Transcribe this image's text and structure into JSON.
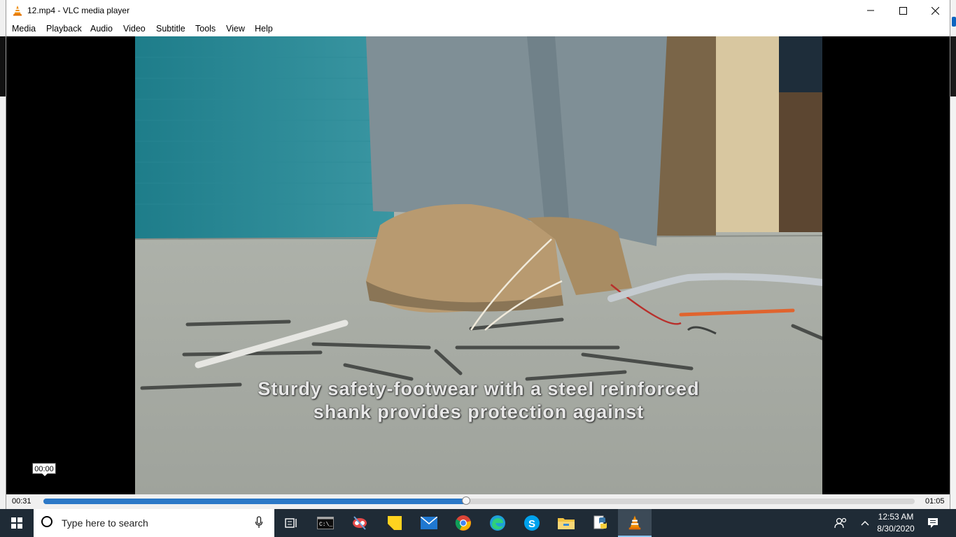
{
  "window": {
    "title": "12.mp4 - VLC media player"
  },
  "menu": [
    "Media",
    "Playback",
    "Audio",
    "Video",
    "Subtitle",
    "Tools",
    "View",
    "Help"
  ],
  "video": {
    "subtitle_line1": "Sturdy safety-footwear with a steel reinforced",
    "subtitle_line2": "shank provides protection against"
  },
  "seek": {
    "hover_time": "00:00",
    "elapsed": "00:31",
    "total": "01:05",
    "progress": 0.485
  },
  "taskbar": {
    "search_placeholder": "Type here to search",
    "time": "12:53 AM",
    "date": "8/30/2020",
    "pinned_icons": [
      "task-view-icon",
      "terminal-icon",
      "snipping-tool-icon",
      "sticky-notes-icon",
      "mail-icon",
      "chrome-icon",
      "edge-icon",
      "skype-icon",
      "file-explorer-icon",
      "python-icon",
      "vlc-icon"
    ],
    "active_app": "vlc-icon"
  },
  "colors": {
    "taskbar_bg": "#1f2b36",
    "seek_fill": "#2b78c7"
  }
}
